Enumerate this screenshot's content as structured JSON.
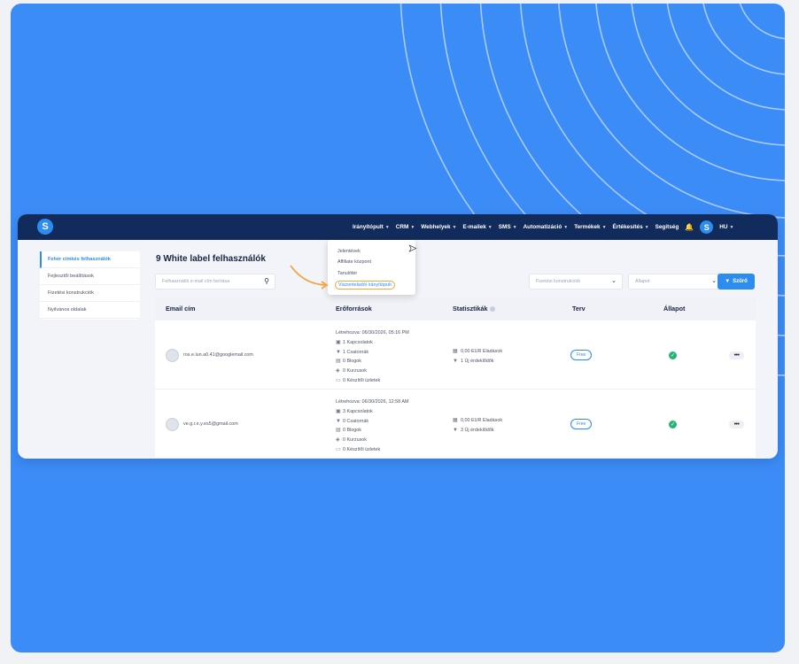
{
  "nav": {
    "logo": "S",
    "menu": [
      {
        "label": "Irányítópult"
      },
      {
        "label": "CRM"
      },
      {
        "label": "Webhelyek"
      },
      {
        "label": "E-mailek"
      },
      {
        "label": "SMS"
      },
      {
        "label": "Automatizáció"
      },
      {
        "label": "Termékek"
      },
      {
        "label": "Értékesítés"
      }
    ],
    "help": "Segítség",
    "user_initial": "S",
    "lang": "HU"
  },
  "dropdown": {
    "items": [
      "Jelentések",
      "Affiliate központ",
      "Tanulótér",
      "Viszonteladói irányítópult"
    ],
    "highlight_color": "#f0a73b"
  },
  "sidebar": {
    "items": [
      {
        "label": "Fehér címkés felhasználók",
        "active": true
      },
      {
        "label": "Fejlesztői beállítások",
        "active": false
      },
      {
        "label": "Fizetési konstrukciók",
        "active": false
      },
      {
        "label": "Nyilvános oldalak",
        "active": false
      }
    ]
  },
  "page": {
    "title": "9 White label felhasználók",
    "search_placeholder": "Felhasználói e-mail cím beírása",
    "plan_filter": "Fizetési konstrukciók",
    "status_filter": "Állapot",
    "filter_button": "Szűrő"
  },
  "table": {
    "headers": {
      "email": "Email cím",
      "resources": "Erőforrások",
      "stats": "Statisztikák",
      "plan": "Terv",
      "status": "Állapot"
    },
    "rows": [
      {
        "email": "ros.e.lun.a0.41@googlemail.com",
        "created": "Létrehozva: 06/30/2026, 05:16 PM",
        "contacts": "1 Kapcsolatok",
        "funnels": "1 Csatornák",
        "blogs": "0 Blogok",
        "courses": "0 Kurzusok",
        "workspaces": "0 Készítői üzletek",
        "sales": "0,00 EUR Eladások",
        "leads": "1 Új érdeklődők",
        "plan": "Free"
      },
      {
        "email": "ve.g.r.e.y.es5@gmail.com",
        "created": "Létrehozva: 06/30/2026, 12:58 AM",
        "contacts": "3 Kapcsolatok",
        "funnels": "0 Csatornák",
        "blogs": "0 Blogok",
        "courses": "0 Kurzusok",
        "workspaces": "0 Készítői üzletek",
        "sales": "0,00 EUR Eladások",
        "leads": "3 Új érdeklődők",
        "plan": "Free"
      }
    ]
  },
  "colors": {
    "background": "#3c8cf8",
    "navbar": "#112c5c",
    "accent": "#2d8cf0",
    "status_ok": "#22b573"
  }
}
